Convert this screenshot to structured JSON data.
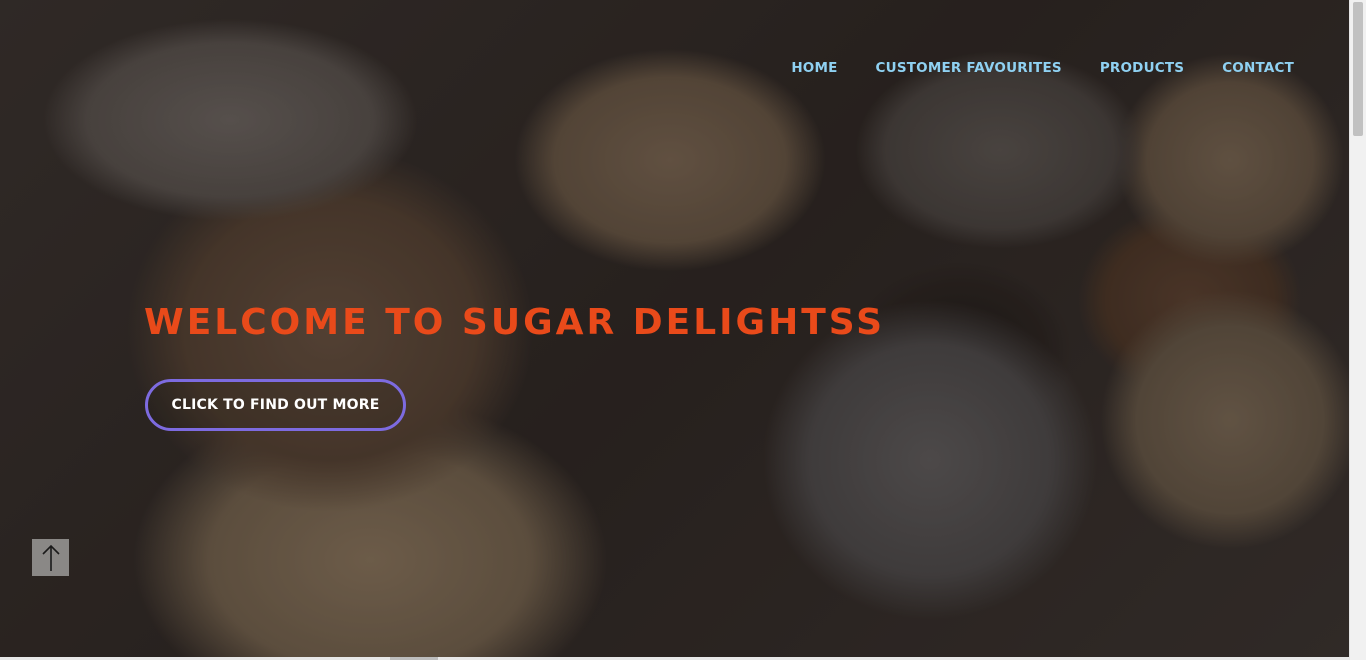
{
  "nav": {
    "items": [
      {
        "label": "HOME"
      },
      {
        "label": "CUSTOMER FAVOURITES"
      },
      {
        "label": "PRODUCTS"
      },
      {
        "label": "CONTACT"
      }
    ]
  },
  "hero": {
    "title": "WELCOME TO SUGAR DELIGHTSS",
    "cta_label": "CLICK TO FIND OUT MORE"
  },
  "back_to_top": {
    "icon": "arrow-up-icon"
  },
  "colors": {
    "nav_link": "#8fd1f2",
    "title": "#e94a1a",
    "cta_border": "#7d6be0",
    "back_to_top_bg": "#8a8886"
  }
}
